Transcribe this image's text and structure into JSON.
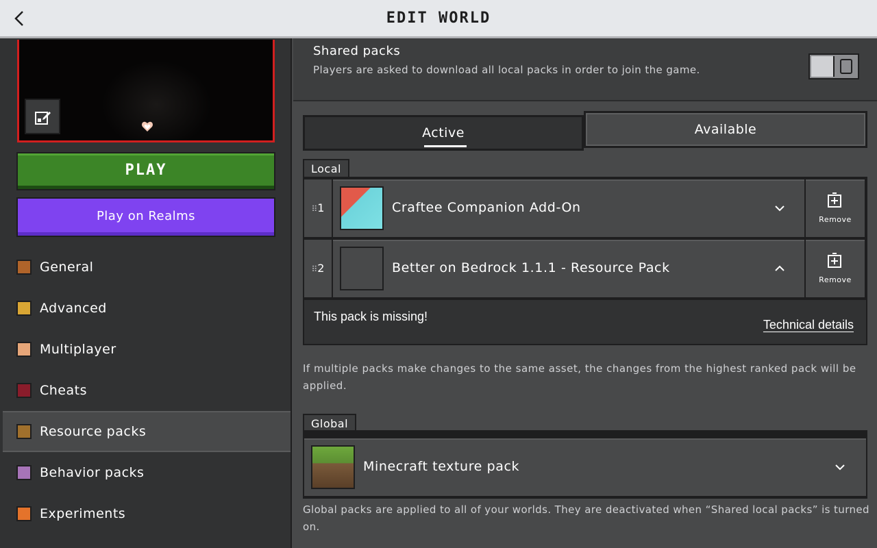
{
  "header": {
    "title": "EDIT WORLD"
  },
  "sidebar": {
    "play_label": "PLAY",
    "realms_label": "Play on Realms",
    "items": [
      {
        "label": "General",
        "icon": "general-icon",
        "color": "#b0642a"
      },
      {
        "label": "Advanced",
        "icon": "advanced-icon",
        "color": "#d9a634"
      },
      {
        "label": "Multiplayer",
        "icon": "multiplayer-icon",
        "color": "#e6a679"
      },
      {
        "label": "Cheats",
        "icon": "cheats-icon",
        "color": "#8a1c2b"
      },
      {
        "label": "Resource packs",
        "icon": "resource-packs-icon",
        "color": "#a0702c"
      },
      {
        "label": "Behavior packs",
        "icon": "behavior-packs-icon",
        "color": "#a774b8"
      },
      {
        "label": "Experiments",
        "icon": "experiments-icon",
        "color": "#e4732b"
      }
    ],
    "active_item": "Resource packs"
  },
  "shared": {
    "title": "Shared packs",
    "description": "Players are asked to download all local packs in order to join the game.",
    "toggle_on": false
  },
  "tabs": {
    "active": "Active",
    "available": "Available"
  },
  "local": {
    "label": "Local",
    "packs": [
      {
        "rank": "1",
        "name": "Craftee Companion Add-On",
        "remove_label": "Remove",
        "expanded": false
      },
      {
        "rank": "2",
        "name": "Better on Bedrock 1.1.1 - Resource Pack",
        "remove_label": "Remove",
        "expanded": true
      }
    ],
    "missing_text": "This pack is missing!",
    "technical_details": "Technical details"
  },
  "info_text": "If multiple packs make changes to the same asset, the changes from the highest ranked pack will be applied.",
  "global": {
    "label": "Global",
    "pack_name": "Minecraft texture pack",
    "info_text": "Global packs are applied to all of your worlds. They are deactivated when “Shared local packs” is turned on."
  },
  "colors": {
    "play_green": "#3c8527",
    "realms_purple": "#7f43f0",
    "preview_border": "#d11f1f"
  }
}
